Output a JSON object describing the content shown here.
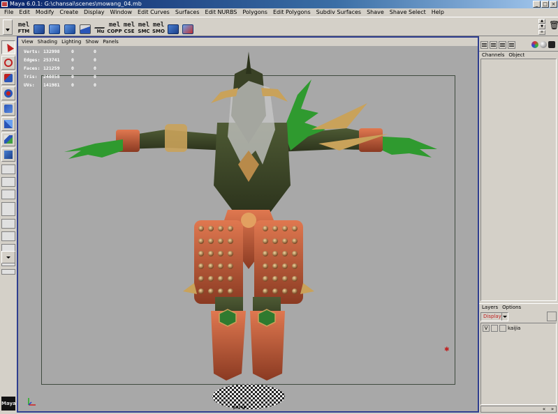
{
  "window": {
    "title": "Maya 6.0.1: G:\\chansai\\scenes\\mowang_04.mb",
    "buttons": [
      "_",
      "□",
      "×"
    ]
  },
  "menubar": {
    "items": [
      "File",
      "Edit",
      "Modify",
      "Create",
      "Display",
      "Window",
      "Edit Curves",
      "Surfaces",
      "Edit NURBS",
      "Polygons",
      "Edit Polygons",
      "Subdiv Surfaces",
      "Shave",
      "Shave Select",
      "Help"
    ]
  },
  "shelf": {
    "buttons": [
      {
        "top": "mel",
        "bottom": "FTM"
      },
      {
        "icon": "cube-select-icon"
      },
      {
        "icon": "cube-blue-icon"
      },
      {
        "icon": "cube-blue-icon"
      },
      {
        "icon": "brush-icon"
      },
      {
        "top": "",
        "bottom": "Hu"
      },
      {
        "top": "mel",
        "bottom": "COPP"
      },
      {
        "top": "mel",
        "bottom": "CSE"
      },
      {
        "top": "mel",
        "bottom": "SMC"
      },
      {
        "top": "mel",
        "bottom": "SMO"
      },
      {
        "icon": "cube-select-icon"
      },
      {
        "icon": "cube-blue-icon"
      }
    ]
  },
  "panel_menu": {
    "items": [
      "View",
      "Shading",
      "Lighting",
      "Show",
      "Panels"
    ]
  },
  "hud": {
    "rows": [
      {
        "label": "Verts:",
        "v1": "132998",
        "v2": "0",
        "v3": "0"
      },
      {
        "label": "Edges:",
        "v1": "253741",
        "v2": "0",
        "v3": "0"
      },
      {
        "label": "Faces:",
        "v1": "121259",
        "v2": "0",
        "v3": "0"
      },
      {
        "label": "Tris:",
        "v1": "240858",
        "v2": "0",
        "v3": "0"
      },
      {
        "label": "UVs:",
        "v1": "141981",
        "v2": "0",
        "v3": "0"
      }
    ]
  },
  "viewport": {
    "camera": "persp",
    "background": "#a8a8a8"
  },
  "channel_box": {
    "menu": [
      "Channels",
      "Object"
    ]
  },
  "layer_editor": {
    "menu": [
      "Layers",
      "Options"
    ],
    "display_value": "Display",
    "layers": [
      {
        "visible": "V",
        "name": "kaijia"
      }
    ]
  },
  "logo": "Maya",
  "colors": {
    "accent": "#2f3e8f",
    "armor_red": "#c8553a",
    "armor_gold": "#c9a25a",
    "claw_green": "#2f9a2f",
    "skin_dark": "#3d4a2b"
  }
}
